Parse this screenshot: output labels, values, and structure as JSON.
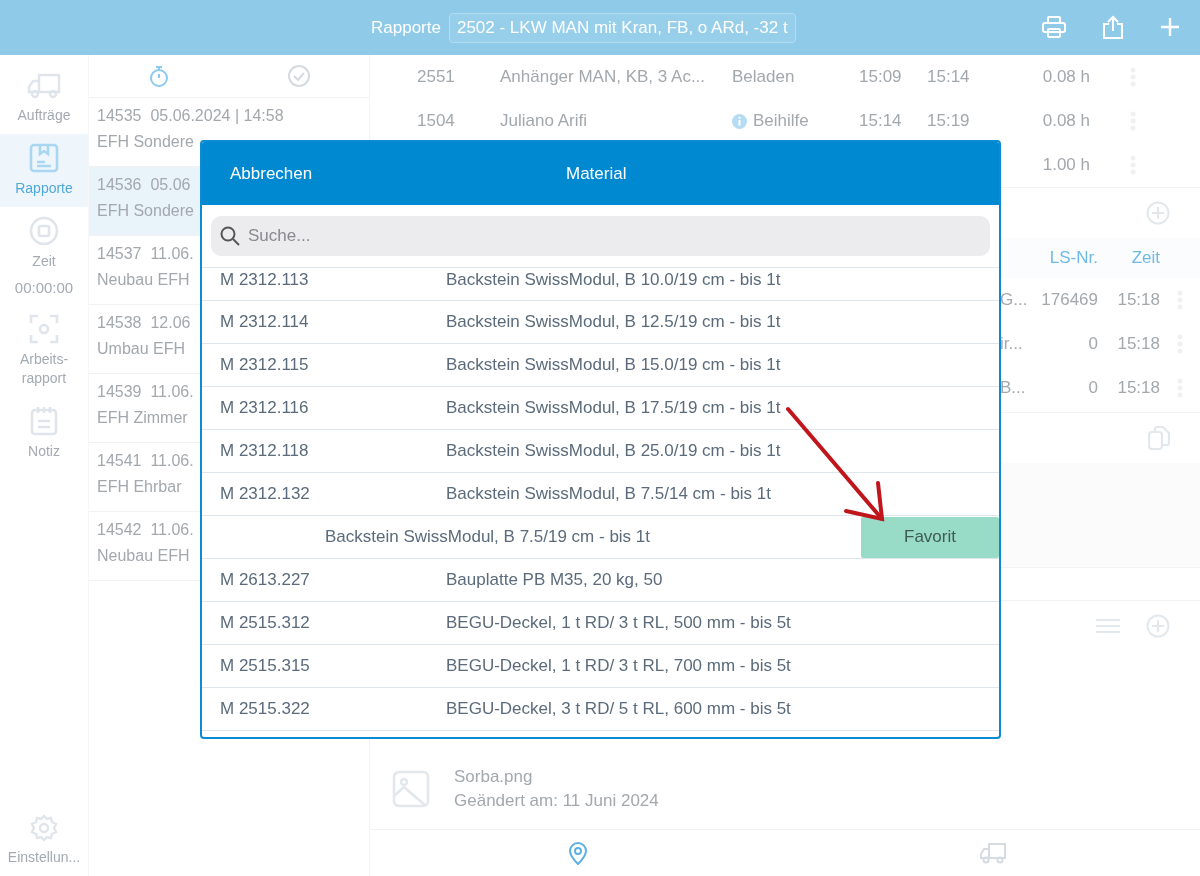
{
  "top_bar": {
    "title": "Rapporte",
    "vehicle": "2502 - LKW MAN mit Kran, FB, o ARd, -32 t"
  },
  "sidebar": {
    "items": [
      {
        "label": "Aufträge",
        "selected": false
      },
      {
        "label": "Rapporte",
        "selected": true
      },
      {
        "label": "Zeit",
        "selected": false,
        "time": "00:00:00"
      },
      {
        "label": "Arbeits-rapport",
        "selected": false
      },
      {
        "label": "Notiz",
        "selected": false
      }
    ],
    "settings": "Einstellun..."
  },
  "list_tabs": [
    {
      "selected": true
    },
    {
      "selected": false
    }
  ],
  "reports": [
    {
      "number": "14535",
      "date": "05.06.2024 | 14:58",
      "title": "EFH Sondere",
      "selected": false
    },
    {
      "number": "14536",
      "date": "05.06",
      "title": "EFH Sondere",
      "selected": true
    },
    {
      "number": "14537",
      "date": "11.06.",
      "title": "Neubau EFH",
      "selected": false
    },
    {
      "number": "14538",
      "date": "12.06",
      "title": "Umbau EFH",
      "selected": false
    },
    {
      "number": "14539",
      "date": "11.06.",
      "title": "EFH Zimmer",
      "selected": false
    },
    {
      "number": "14541",
      "date": "11.06.",
      "title": "EFH Ehrbar",
      "selected": false
    },
    {
      "number": "14542",
      "date": "11.06.",
      "title": "Neubau EFH",
      "selected": false
    }
  ],
  "work_rows": [
    {
      "code": "2551",
      "name": "Anhänger MAN, KB, 3 Ac...",
      "info": false,
      "activity": "Beladen",
      "start": "15:09",
      "end": "15:14",
      "duration": "0.08 h"
    },
    {
      "code": "1504",
      "name": "Juliano Arifi",
      "info": true,
      "activity": "Beihilfe",
      "start": "15:14",
      "end": "15:19",
      "duration": "0.08 h"
    },
    {
      "duration": "1.00 h"
    }
  ],
  "delivery": {
    "columns": [
      "LS-Nr.",
      "Zeit"
    ],
    "rows": [
      {
        "item": "G...",
        "ls_nr": "176469",
        "time": "15:18"
      },
      {
        "item": "ir...",
        "ls_nr": "0",
        "time": "15:18"
      },
      {
        "item": "B...",
        "ls_nr": "0",
        "time": "15:18"
      }
    ]
  },
  "attachment": {
    "name": "Sorba.png",
    "modified": "Geändert am: 11 Juni 2024"
  },
  "bottom_tabs": [
    {
      "selected": true
    },
    {
      "selected": false
    }
  ],
  "modal": {
    "cancel": "Abbrechen",
    "title": "Material",
    "search_placeholder": "Suche...",
    "materials": [
      {
        "kind": "row",
        "code": "M 2312.113",
        "name": "Backstein SwissModul, B 10.0/19 cm - bis 1t"
      },
      {
        "kind": "row",
        "code": "M 2312.114",
        "name": "Backstein SwissModul, B 12.5/19 cm - bis 1t"
      },
      {
        "kind": "row",
        "code": "M 2312.115",
        "name": "Backstein SwissModul, B 15.0/19 cm - bis 1t"
      },
      {
        "kind": "row",
        "code": "M 2312.116",
        "name": "Backstein SwissModul, B 17.5/19 cm - bis 1t"
      },
      {
        "kind": "row",
        "code": "M 2312.118",
        "name": "Backstein SwissModul, B 25.0/19 cm - bis 1t"
      },
      {
        "kind": "row",
        "code": "M 2312.132",
        "name": "Backstein SwissModul, B 7.5/14 cm - bis 1t"
      },
      {
        "kind": "swiped",
        "name": "Backstein SwissModul, B 7.5/19 cm - bis 1t",
        "action": "Favorit"
      },
      {
        "kind": "row",
        "code": "M 2613.227",
        "name": "Bauplatte PB M35, 20 kg,  50"
      },
      {
        "kind": "row",
        "code": "M 2515.312",
        "name": "BEGU-Deckel, 1 t RD/ 3 t RL, 500 mm - bis 5t"
      },
      {
        "kind": "row",
        "code": "M 2515.315",
        "name": "BEGU-Deckel, 1 t RD/ 3 t RL, 700 mm - bis 5t"
      },
      {
        "kind": "row",
        "code": "M 2515.322",
        "name": "BEGU-Deckel, 3 t RD/ 5 t RL, 600 mm - bis 5t"
      }
    ]
  }
}
